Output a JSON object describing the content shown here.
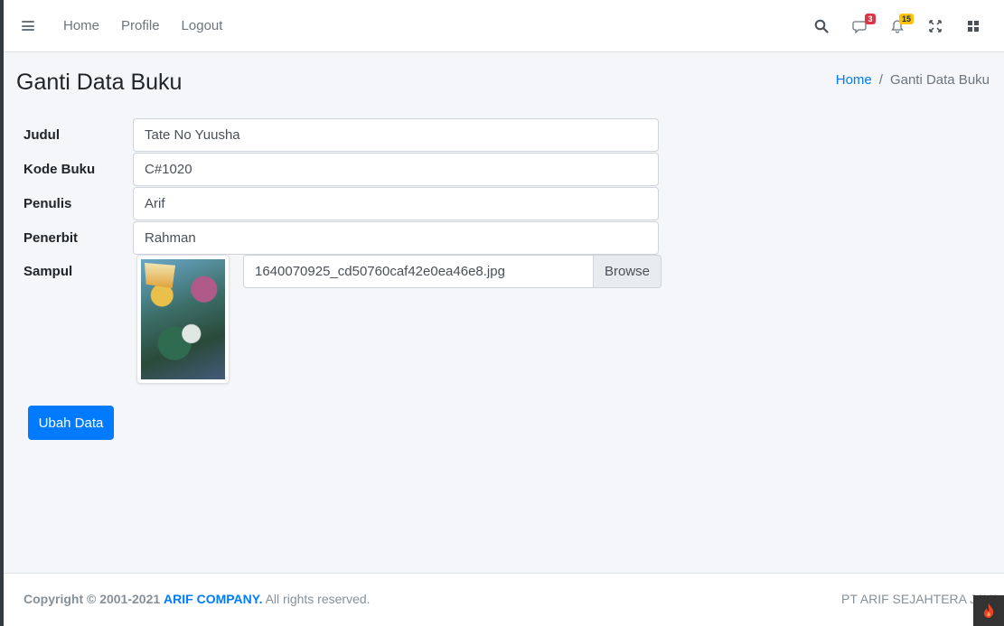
{
  "navbar": {
    "links": [
      "Home",
      "Profile",
      "Logout"
    ],
    "messages_badge": "3",
    "notifications_badge": "15"
  },
  "header": {
    "title": "Ganti Data Buku",
    "breadcrumb_home": "Home",
    "breadcrumb_separator": "/",
    "breadcrumb_current": "Ganti Data Buku"
  },
  "form": {
    "judul_label": "Judul",
    "judul_value": "Tate No Yuusha",
    "kode_label": "Kode Buku",
    "kode_value": "C#1020",
    "penulis_label": "Penulis",
    "penulis_value": "Arif",
    "penerbit_label": "Penerbit",
    "penerbit_value": "Rahman",
    "sampul_label": "Sampul",
    "file_name": "1640070925_cd50760caf42e0ea46e8.jpg",
    "browse_label": "Browse",
    "submit_label": "Ubah Data"
  },
  "footer": {
    "copyright_prefix": "Copyright © 2001-2021",
    "company": "ARIF COMPANY.",
    "copyright_suffix": "All rights reserved.",
    "right_text": "PT ARIF SEJAHTERA JAYA"
  },
  "colors": {
    "primary": "#007bff",
    "badge_danger": "#dc3545",
    "badge_warning": "#ffc107"
  }
}
